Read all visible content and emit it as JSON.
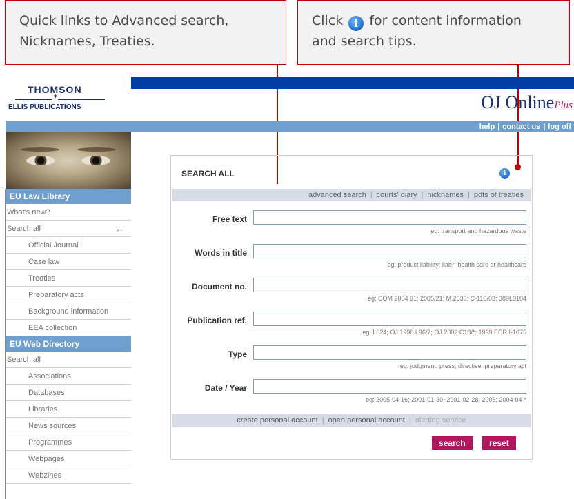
{
  "callouts": [
    {
      "line1": "Quick links to Advanced search,",
      "line2": "Nicknames, Treaties."
    },
    {
      "prefix": "Click",
      "icon": "info-icon",
      "suffix": "for content information",
      "line2": "and search tips."
    }
  ],
  "header": {
    "logo_line1": "THOMSON",
    "logo_line2": "ELLIS PUBLICATIONS",
    "brand": "OJ Online",
    "brand_plus": "Plus",
    "links": [
      "help",
      "contact us",
      "log off"
    ]
  },
  "sidebar": {
    "section1": "EU Law Library",
    "items1": [
      {
        "label": "What's new?",
        "sub": false
      },
      {
        "label": "Search all",
        "sub": false,
        "active": true,
        "marker": "←"
      },
      {
        "label": "Official Journal",
        "sub": true
      },
      {
        "label": "Case law",
        "sub": true
      },
      {
        "label": "Treaties",
        "sub": true
      },
      {
        "label": "Preparatory acts",
        "sub": true
      },
      {
        "label": "Background information",
        "sub": true
      },
      {
        "label": "EEA collection",
        "sub": true
      }
    ],
    "section2": "EU Web Directory",
    "items2": [
      {
        "label": "Search all",
        "sub": false
      },
      {
        "label": "Associations",
        "sub": true
      },
      {
        "label": "Databases",
        "sub": true
      },
      {
        "label": "Libraries",
        "sub": true
      },
      {
        "label": "News sources",
        "sub": true
      },
      {
        "label": "Programmes",
        "sub": true
      },
      {
        "label": "Webpages",
        "sub": true
      },
      {
        "label": "Webzines",
        "sub": true
      }
    ]
  },
  "search": {
    "title": "SEARCH ALL",
    "quick_links": [
      "advanced search",
      "courts' diary",
      "nicknames",
      "pdfs of treaties"
    ],
    "fields": [
      {
        "label": "Free text",
        "value": "",
        "hint": "eg: transport and hazardous waste"
      },
      {
        "label": "Words in title",
        "value": "",
        "hint": "eg: product liability; liab*; health care or healthcare"
      },
      {
        "label": "Document no.",
        "value": "",
        "hint": "eg: COM 2004 91; 2005/21; M.2533; C-110/03; 389L0104"
      },
      {
        "label": "Publication ref.",
        "value": "",
        "hint": "eg: L024; OJ 1998 L96/7; OJ 2002 C18/*; 1999 ECR I-1075"
      },
      {
        "label": "Type",
        "value": "",
        "hint": "eg: judgment; press; directive; preparatory act"
      },
      {
        "label": "Date / Year",
        "value": "",
        "hint": "eg: 2005-04-16; 2001-01-30~2001-02-28; 2006; 2004-04-*"
      }
    ],
    "account_links": [
      "create personal account",
      "open personal account"
    ],
    "account_disabled": "alerting service",
    "search_button": "search",
    "reset_button": "reset"
  },
  "colors": {
    "accent": "#c00000",
    "header_blue": "#003da5",
    "nav_blue": "#6f9fcf",
    "button": "#b0175e"
  }
}
